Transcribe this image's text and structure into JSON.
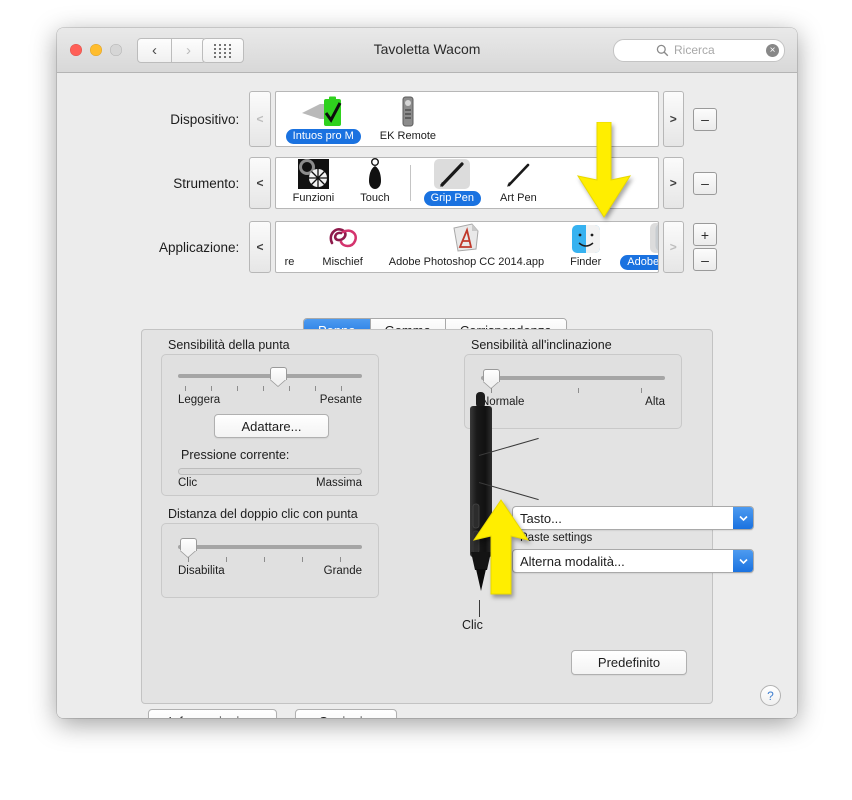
{
  "window": {
    "title": "Tavoletta Wacom",
    "search_placeholder": "Ricerca",
    "nav_back": "‹",
    "nav_forward": "›",
    "grid_icon": "grid-icon",
    "search_icon": "search-icon",
    "clear_icon": "×"
  },
  "rows": {
    "device": {
      "label": "Dispositivo:",
      "left_arrow": "<",
      "right_arrow": ">",
      "remove": "–",
      "items": [
        {
          "name": "Intuos pro M",
          "icon": "tablet-battery-icon",
          "selected": true
        },
        {
          "name": "EK Remote",
          "icon": "remote-icon",
          "selected": false
        }
      ]
    },
    "tool": {
      "label": "Strumento:",
      "left_arrow": "<",
      "right_arrow": ">",
      "remove": "–",
      "items": [
        {
          "name": "Funzioni",
          "icon": "functions-icon",
          "selected": false
        },
        {
          "name": "Touch",
          "icon": "touch-finger-icon",
          "selected": false
        },
        {
          "name": "Grip Pen",
          "icon": "pen-icon",
          "selected": true
        },
        {
          "name": "Art Pen",
          "icon": "art-pen-icon",
          "selected": false
        }
      ]
    },
    "application": {
      "label": "Applicazione:",
      "left_arrow": "<",
      "right_arrow": ">",
      "add": "+",
      "remove": "–",
      "clipped_prefix": "re",
      "items": [
        {
          "name": "Mischief",
          "icon": "mischief-icon",
          "selected": false
        },
        {
          "name": "Adobe Photoshop CC 2014.app",
          "icon": "photoshop-icon",
          "selected": false
        },
        {
          "name": "Finder",
          "icon": "finder-icon",
          "selected": false
        },
        {
          "name": "Adobe Lightroom",
          "icon": "lightroom-icon",
          "selected": true
        }
      ]
    }
  },
  "tabs": [
    {
      "label": "Penna",
      "active": true
    },
    {
      "label": "Gomma",
      "active": false
    },
    {
      "label": "Corrispondenza",
      "active": false
    }
  ],
  "tip_sensitivity": {
    "title": "Sensibilità della punta",
    "min_label": "Leggera",
    "max_label": "Pesante",
    "value_percent": 55,
    "adapt_button": "Adattare...",
    "current_pressure_label": "Pressione corrente:",
    "pressure_min_label": "Clic",
    "pressure_max_label": "Massima",
    "pressure_percent": 0
  },
  "double_click": {
    "title": "Distanza del doppio clic con punta",
    "min_label": "Disabilita",
    "max_label": "Grande",
    "value_percent": 2
  },
  "tilt_sensitivity": {
    "title": "Sensibilità all'inclinazione",
    "min_label": "Normale",
    "max_label": "Alta",
    "value_percent": 2
  },
  "pen_controls": {
    "upper_button": "Tasto...",
    "upper_caption": "Paste settings",
    "lower_button": "Alterna modalità...",
    "tip_label": "Clic",
    "dropdown_arrow": "⌄"
  },
  "buttons": {
    "default": "Predefinito",
    "about": "Informazioni su",
    "options": "Opzioni...",
    "help": "?"
  },
  "annotations": {
    "arrow_top": "yellow-arrow-down",
    "arrow_bottom": "yellow-arrow-up"
  },
  "colors": {
    "accent_blue": "#1a72e0",
    "annotation_yellow": "#ffee00",
    "window_bg": "#ececec",
    "panel_bg": "#e0e0e0"
  }
}
